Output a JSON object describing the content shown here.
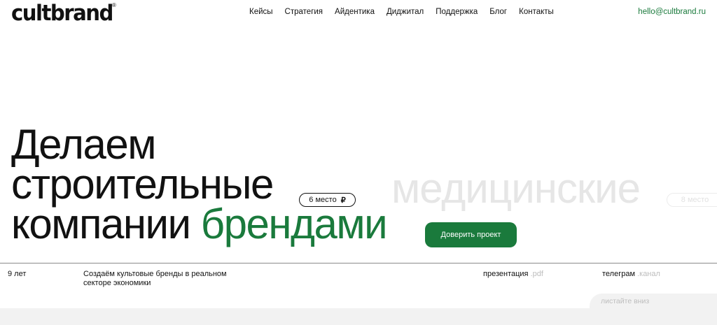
{
  "header": {
    "logo": "cultbrand",
    "logo_mark": "®",
    "nav": [
      "Кейсы",
      "Стратегия",
      "Айдентика",
      "Диджитал",
      "Поддержка",
      "Блог",
      "Контакты"
    ],
    "email": "hello@cultbrand.ru"
  },
  "hero": {
    "line1": "Делаем",
    "line2": "строительные",
    "line3_a": "компании",
    "line3_b": "брендами",
    "ghost_word": "медицинские",
    "badge_label": "6 место",
    "ghost_badge_label": "8 место",
    "cta_label": "Доверить проект"
  },
  "footer_bar": {
    "years": "9 лет",
    "description": "Создаём культовые бренды в реальном секторе экономики",
    "presentation": "презентация",
    "presentation_ext": ".pdf",
    "telegram": "телеграм",
    "telegram_suffix": ".канал",
    "scroll_hint": "листайте вниз"
  },
  "colors": {
    "accent": "#1a7a3c",
    "text": "#111111",
    "ghost": "#e6e6e6"
  },
  "icons": [
    "rub-sign-icon"
  ]
}
